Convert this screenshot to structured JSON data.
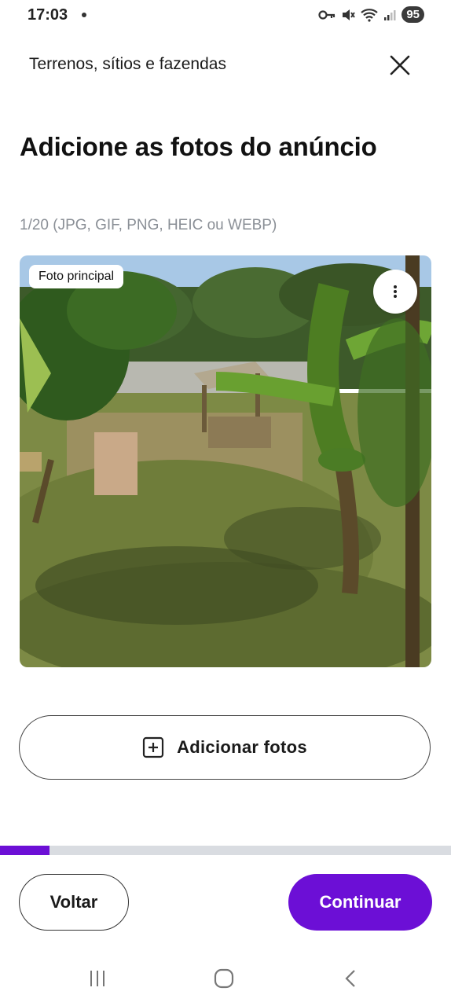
{
  "status_bar": {
    "time": "17:03",
    "battery": "95",
    "icons": [
      "key-icon",
      "mute-icon",
      "wifi-icon",
      "signal-icon"
    ]
  },
  "header": {
    "title": "Terrenos, sítios e fazendas",
    "close_icon": "close-icon"
  },
  "main": {
    "title": "Adicione as fotos do anúncio",
    "photo_count": "1/20 (JPG, GIF, PNG, HEIC ou WEBP)",
    "photos": [
      {
        "badge": "Foto principal",
        "menu_icon": "more-vertical-icon"
      }
    ],
    "add_photos_label": "Adicionar fotos"
  },
  "progress": {
    "value": 0.11
  },
  "footer": {
    "back_label": "Voltar",
    "continue_label": "Continuar"
  },
  "colors": {
    "accent": "#6c0fd6",
    "progress_track": "#d9dce1",
    "muted_text": "#8a8f96"
  }
}
